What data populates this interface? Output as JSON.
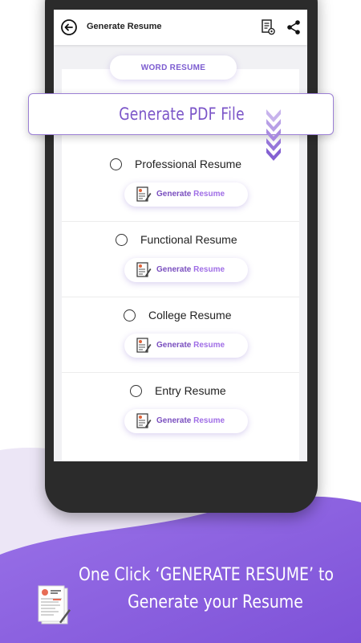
{
  "app_bar": {
    "title": "Generate Resume",
    "back_icon": "back-arrow-icon",
    "doc_icon": "document-settings-icon",
    "share_icon": "share-icon"
  },
  "section_tab": "WORD RESUME",
  "banner": {
    "title": "Generate PDF File"
  },
  "resume_options": [
    {
      "label": "Professional Resume",
      "button_part1": "Generate",
      "button_part2": "Resume"
    },
    {
      "label": "Functional Resume",
      "button_part1": "Generate",
      "button_part2": "Resume"
    },
    {
      "label": "College Resume",
      "button_part1": "Generate",
      "button_part2": "Resume"
    },
    {
      "label": "Entry Resume",
      "button_part1": "Generate",
      "button_part2": "Resume"
    }
  ],
  "caption": {
    "line1": "One Click ‘GENERATE RESUME’ to",
    "line2": "Generate your Resume"
  },
  "colors": {
    "accent": "#7b55c8",
    "accent_light": "#a06ee6",
    "bg_wave": "#8e60e2"
  }
}
